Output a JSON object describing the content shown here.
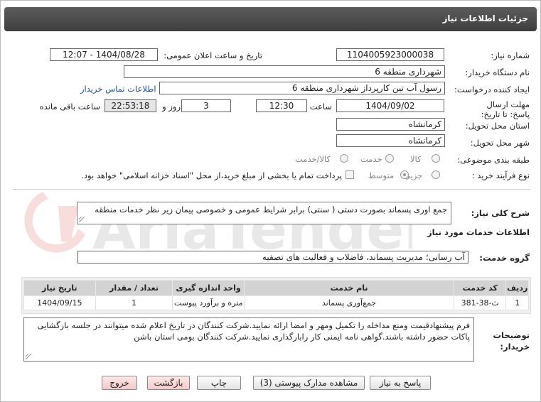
{
  "header": {
    "title": "جزئیات اطلاعات نیاز"
  },
  "fields": {
    "need_number_label": "شماره نیاز:",
    "need_number": "1104005923000038",
    "announce_label": "تاریخ و ساعت اعلان عمومی:",
    "announce_value": "1404/08/28 - 12:07",
    "buyer_label": "نام دستگاه خریدار:",
    "buyer_value": "شهرداری منطقه 6",
    "creator_label": "ایجاد کننده درخواست:",
    "creator_value": "رسول آب تین کارپرداز شهرداری منطقه 6",
    "contact_link": "اطلاعات تماس خریدار",
    "deadline_label": "مهلت ارسال پاسخ: تا تاریخ:",
    "deadline_date": "1404/09/02",
    "time_label": "ساعت",
    "deadline_time": "12:30",
    "days_value": "3",
    "days_label": "روز و",
    "remaining_time": "22:53:18",
    "remaining_label": "ساعت باقی مانده",
    "province_label": "استان محل تحویل:",
    "province_value": "کرمانشاه",
    "city_label": "شهر محل تحویل:",
    "city_value": "کرمانشاه",
    "category_label": "طبقه بندی موضوعی:",
    "category_options": [
      "کالا",
      "خدمت",
      "کالا/خدمت"
    ],
    "purchase_label": "نوع فرآیند خرید :",
    "purchase_options": [
      "جزیی",
      "متوسط"
    ],
    "payment_note": "پرداخت تمام یا بخشی از مبلغ خرید،از محل \"اسناد خزانه اسلامی\" خواهد بود."
  },
  "summary": {
    "label": "شرح کلی نیاز:",
    "value": "جمع اوری پسماند بصورت دستی ( سنتی) برابر شرایط عمومی و خصوصی پیمان زیر نظر خدمات منطقه"
  },
  "services": {
    "section_title": "اطلاعات خدمات مورد نیاز",
    "group_label": "گروه خدمت:",
    "group_value": "آب رسانی؛ مدیریت پسماند، فاضلاب و فعالیت های تصفیه",
    "columns": [
      "ردیف",
      "کد خدمت",
      "نام خدمت",
      "واحد اندازه گیری",
      "تعداد / مقدار",
      "تاریخ نیاز"
    ],
    "rows": [
      [
        "1",
        "ث-38-381",
        "جمع‌آوری پسماند",
        "متره و برآورد پیوست",
        "1",
        "1404/09/15"
      ]
    ]
  },
  "notes": {
    "label_line1": "توضیحات",
    "label_line2": "خریدار:",
    "value": "فرم پیشنهادقیمت ومنع مداخله را تکمیل ومهر و امضا ارائه نمایید.شرکت کنندگان در تاریخ اعلام شده میتوانند در جلسه بازگشایی پاکات حضور داشته باشند.گواهی نامه ایمنی کار  رابارگذاری نمایید.شرکت کنندگان بومی استان باشن"
  },
  "buttons": {
    "reply": "پاسخ به نیاز",
    "docs": "مشاهده مدارک پیوستی (3)",
    "print": "چاپ",
    "back": "بازگشت",
    "exit": "خروج"
  },
  "watermark": {
    "text": "AriaTender.net"
  }
}
